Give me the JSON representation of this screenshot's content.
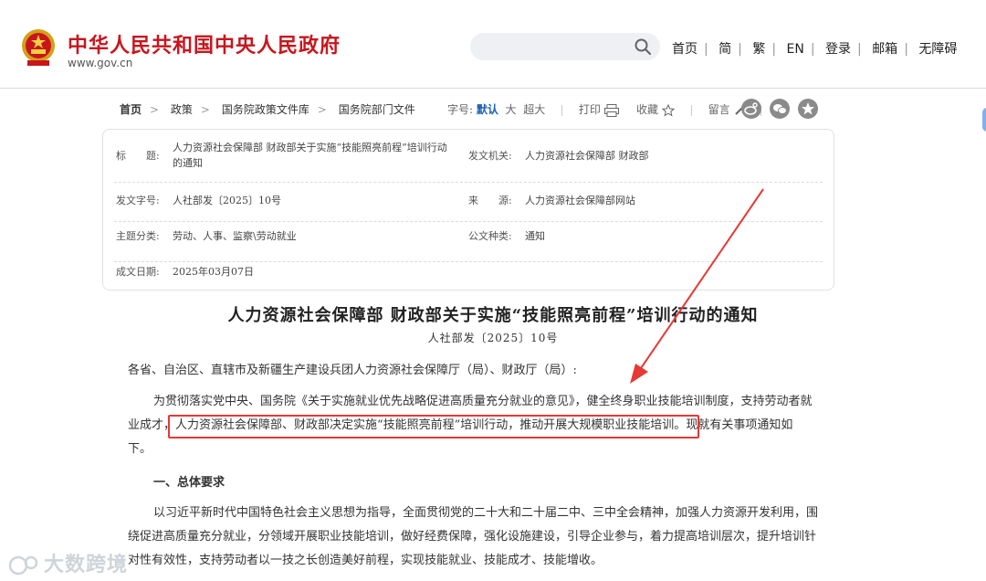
{
  "header": {
    "site_title": "中华人民共和国中央人民政府",
    "site_domain": "www.gov.cn",
    "search_placeholder": "",
    "nav": [
      "首页",
      "简",
      "繁",
      "EN",
      "登录",
      "邮箱",
      "无障碍"
    ]
  },
  "breadcrumb": [
    "首页",
    "政策",
    "国务院政策文件库",
    "国务院部门文件"
  ],
  "toolbar": {
    "font_label": "字号:",
    "font_default": "默认",
    "font_large": "大",
    "font_xlarge": "超大",
    "print": "打印",
    "favorite": "收藏",
    "comment": "留言"
  },
  "share_icons": [
    "weibo-icon",
    "wechat-icon",
    "qzone-icon"
  ],
  "info": {
    "title_label": "标　　题:",
    "title_line1": "人力资源社会保障部 财政部关于实施“技能照亮前程”培训行动",
    "title_line2": "的通知",
    "issuer_label": "发文机关:",
    "issuer": "人力资源社会保障部 财政部",
    "docno_label": "发文字号:",
    "docno": "人社部发〔2025〕10号",
    "source_label": "来　　源:",
    "source": "人力资源社会保障部网站",
    "topic_label": "主题分类:",
    "topic": "劳动、人事、监察\\劳动就业",
    "type_label": "公文种类:",
    "type": "通知",
    "date_label": "成文日期:",
    "date": "2025年03月07日"
  },
  "article": {
    "title": "人力资源社会保障部 财政部关于实施“技能照亮前程”培训行动的通知",
    "doc_no": "人社部发〔2025〕10号",
    "salutation": "各省、自治区、直辖市及新疆生产建设兵团人力资源社会保障厅（局）、财政厅（局）:",
    "p1_line1": "为贯彻落实党中央、国务院《关于实施就业优先战略促进高质量充分就业的意见》，健全终身职业技能培训制度，支持劳动者就",
    "p1_line2a": "业成才，",
    "p1_line2b": "人力资源社会保障部、财政部决定实施“技能照亮前程”培训行动，推动开展大规模职业技能培训。",
    "p1_line2c": "现就有关事项通知如",
    "p1_line3": "下。",
    "section1": "一、总体要求",
    "p2_line1": "以习近平新时代中国特色社会主义思想为指导，全面贯彻党的二十大和二十届二中、三中全会精神，加强人力资源开发利用，围",
    "p2_line2": "绕促进高质量充分就业，分领域开展职业技能培训，做好经费保障，强化设施建设，引导企业参与，着力提高培训层次，提升培训针",
    "p2_line3": "对性有效性，支持劳动者以一技之长创造美好前程，实现技能就业、技能成才、技能增收。"
  },
  "watermark": "大数跨境",
  "colors": {
    "brand_red": "#c8161d",
    "highlight": "#e53935",
    "link_blue": "#1a5fb4"
  }
}
